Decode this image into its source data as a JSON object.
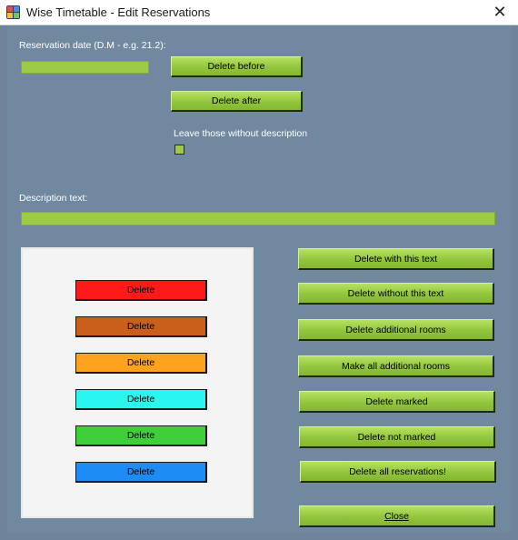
{
  "window": {
    "title": "Wise Timetable - Edit Reservations",
    "close_glyph": "✕"
  },
  "date_section": {
    "label": "Reservation date (D.M - e.g. 21.2):",
    "value": "",
    "delete_before": "Delete before",
    "delete_after": "Delete after",
    "leave_label": "Leave those without description",
    "leave_checked": false
  },
  "description_section": {
    "label": "Description text:",
    "value": ""
  },
  "color_buttons": [
    {
      "label": "Delete",
      "color": "#ff1a1a"
    },
    {
      "label": "Delete",
      "color": "#c8601c"
    },
    {
      "label": "Delete",
      "color": "#ffa21e"
    },
    {
      "label": "Delete",
      "color": "#2af5ef"
    },
    {
      "label": "Delete",
      "color": "#3fcf3a"
    },
    {
      "label": "Delete",
      "color": "#1e8cf5"
    }
  ],
  "action_buttons": {
    "delete_with_text": "Delete with this text",
    "delete_without_text": "Delete without this text",
    "delete_additional_rooms": "Delete additional rooms",
    "make_all_additional_rooms": "Make all additional rooms",
    "delete_marked": "Delete marked",
    "delete_not_marked": "Delete not marked",
    "delete_all": "Delete all reservations!",
    "close": "Close"
  },
  "colors": {
    "accent_green": "#9acd45",
    "background": "#7089a0"
  }
}
